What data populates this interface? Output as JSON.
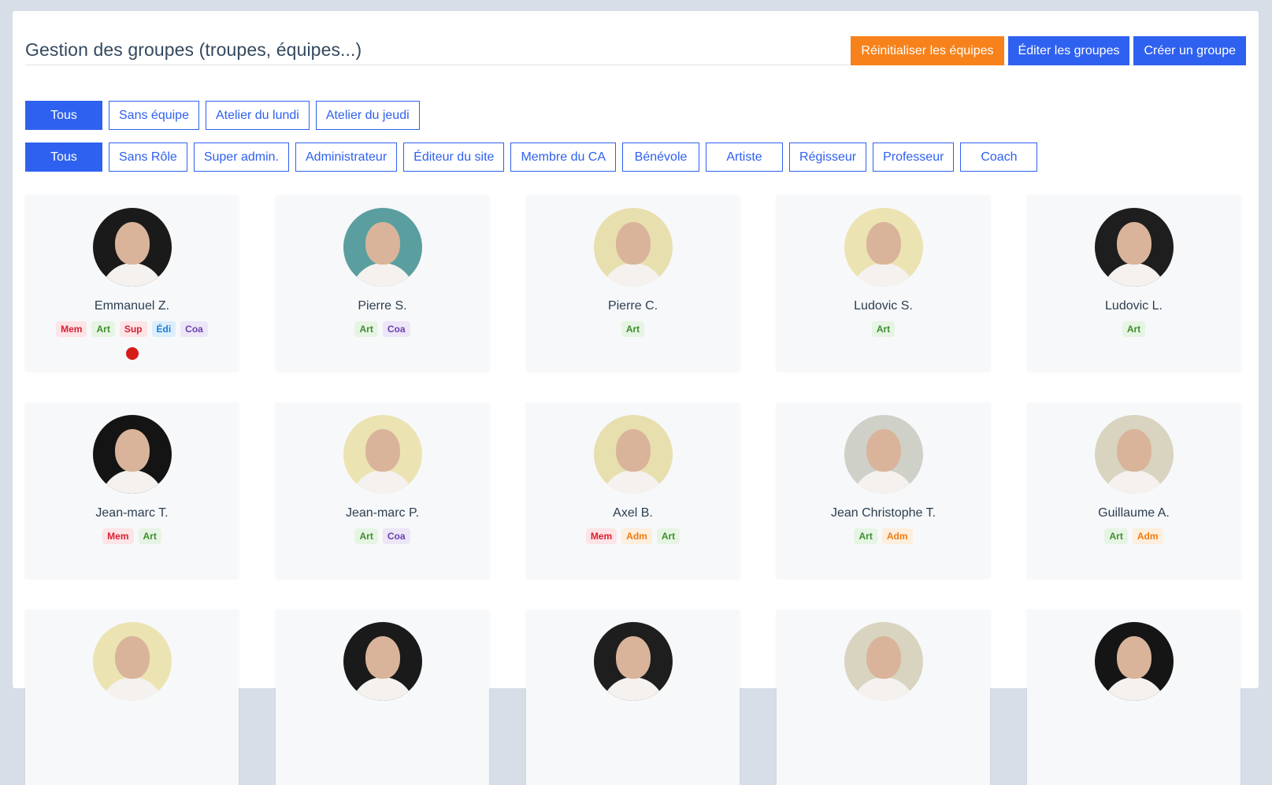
{
  "header": {
    "title": "Gestion des groupes (troupes, équipes...)",
    "actions": {
      "reset": "Réinitialiser les équipes",
      "edit": "Éditer les groupes",
      "create": "Créer un groupe"
    }
  },
  "team_filters": [
    "Tous",
    "Sans équipe",
    "Atelier du lundi",
    "Atelier du jeudi"
  ],
  "role_filters": [
    "Tous",
    "Sans Rôle",
    "Super admin.",
    "Administrateur",
    "Éditeur du site",
    "Membre du CA",
    "Bénévole",
    "Artiste",
    "Régisseur",
    "Professeur",
    "Coach"
  ],
  "active_filters": {
    "team": "Tous",
    "role": "Tous"
  },
  "colors": {
    "primary": "#2f61f0",
    "warning": "#f7821b",
    "status_dot": "#d61b1b"
  },
  "members": [
    {
      "name": "Emmanuel Z.",
      "tags": [
        "Mem",
        "Art",
        "Sup",
        "Édi",
        "Coa"
      ],
      "status_dot": true,
      "avatar_bg": "#1a1a1a"
    },
    {
      "name": "Pierre S.",
      "tags": [
        "Art",
        "Coa"
      ],
      "avatar_bg": "#5b9ea0"
    },
    {
      "name": "Pierre C.",
      "tags": [
        "Art"
      ],
      "avatar_bg": "#e8dfae"
    },
    {
      "name": "Ludovic S.",
      "tags": [
        "Art"
      ],
      "avatar_bg": "#ece3b2"
    },
    {
      "name": "Ludovic L.",
      "tags": [
        "Art"
      ],
      "avatar_bg": "#1e1e1e"
    },
    {
      "name": "Jean-marc T.",
      "tags": [
        "Mem",
        "Art"
      ],
      "avatar_bg": "#141414"
    },
    {
      "name": "Jean-marc P.",
      "tags": [
        "Art",
        "Coa"
      ],
      "avatar_bg": "#ece3b2"
    },
    {
      "name": "Axel B.",
      "tags": [
        "Mem",
        "Adm",
        "Art"
      ],
      "avatar_bg": "#e8dfae"
    },
    {
      "name": "Jean Christophe T.",
      "tags": [
        "Art",
        "Adm"
      ],
      "avatar_bg": "#cfd0c8"
    },
    {
      "name": "Guillaume A.",
      "tags": [
        "Art",
        "Adm"
      ],
      "avatar_bg": "#d8d4c0"
    },
    {
      "name": "",
      "tags": [],
      "avatar_bg": "#ece3b2"
    },
    {
      "name": "",
      "tags": [],
      "avatar_bg": "#1a1a1a"
    },
    {
      "name": "",
      "tags": [],
      "avatar_bg": "#1e1e1e"
    },
    {
      "name": "",
      "tags": [],
      "avatar_bg": "#d8d4c0"
    },
    {
      "name": "",
      "tags": [],
      "avatar_bg": "#151515"
    }
  ]
}
